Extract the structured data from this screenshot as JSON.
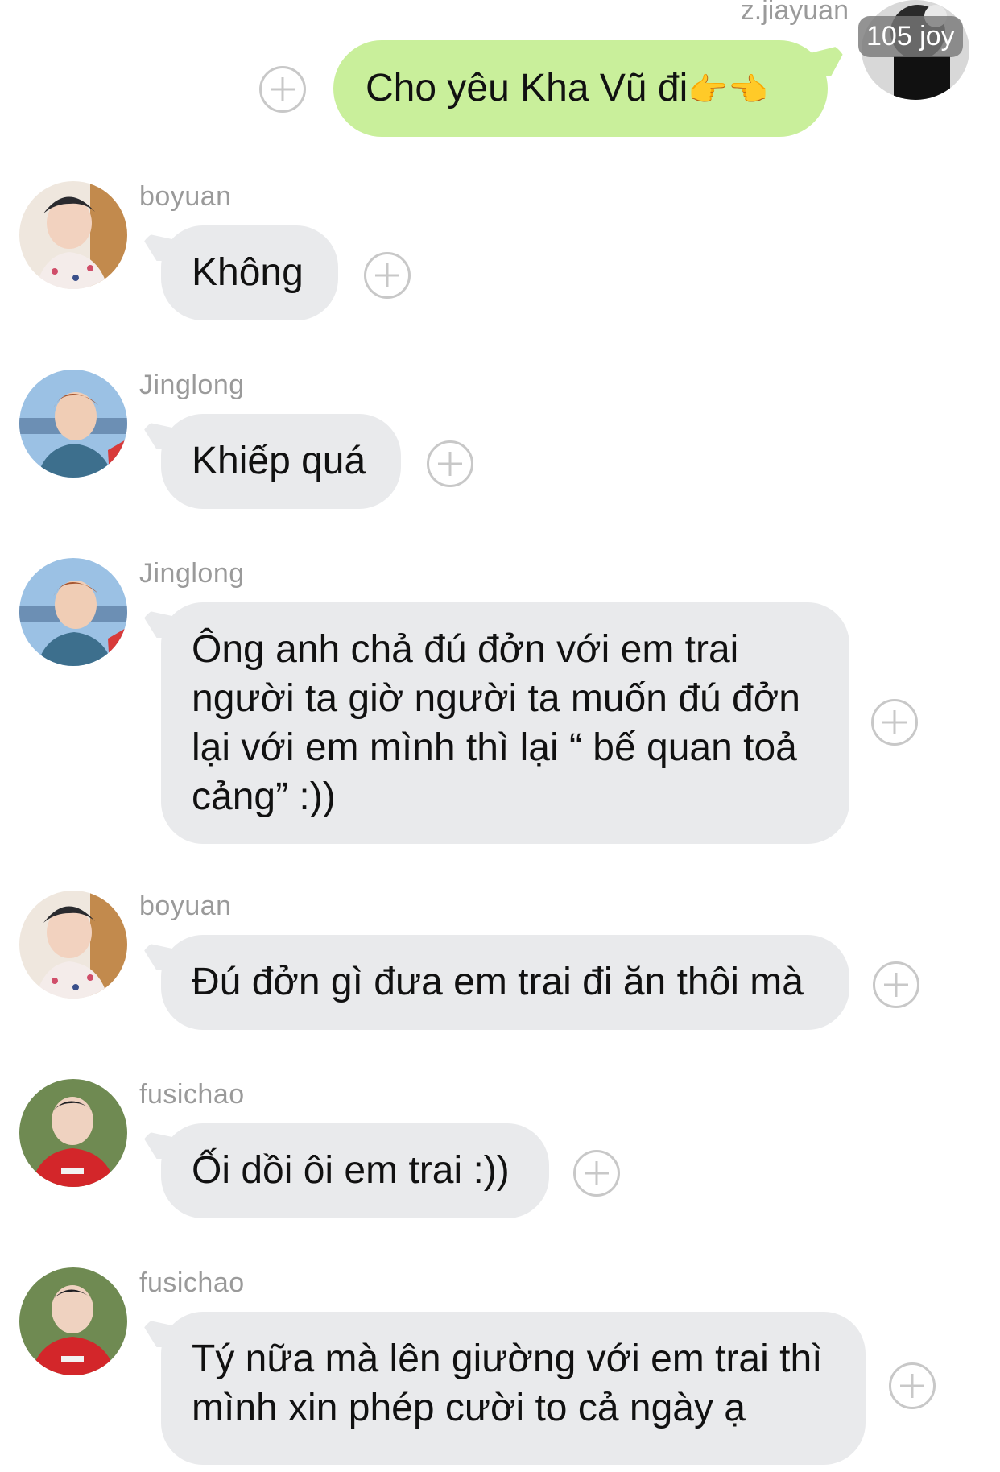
{
  "self": {
    "name": "z.jiayuan",
    "badge": "105 joy",
    "message": "Cho yêu Kha Vũ đi",
    "emoji": "👉👈"
  },
  "messages": [
    {
      "sender": "boyuan",
      "text": "Không"
    },
    {
      "sender": "Jinglong",
      "text": "Khiếp quá"
    },
    {
      "sender": "Jinglong",
      "lines": [
        "Ông anh chả đú đởn với em trai",
        "người ta giờ người ta muốn đú đởn",
        "lại với em mình thì lại “ bế quan toả",
        "cảng” :))"
      ]
    },
    {
      "sender": "boyuan",
      "text": "Đú đởn gì đưa em trai đi ăn thôi mà"
    },
    {
      "sender": "fusichao",
      "text": "Ối dồi ôi em trai :))"
    },
    {
      "sender": "fusichao",
      "lines": [
        "Tý nữa mà lên giường với em trai thì",
        "mình xin phép cười to cả ngày ạ"
      ]
    }
  ]
}
